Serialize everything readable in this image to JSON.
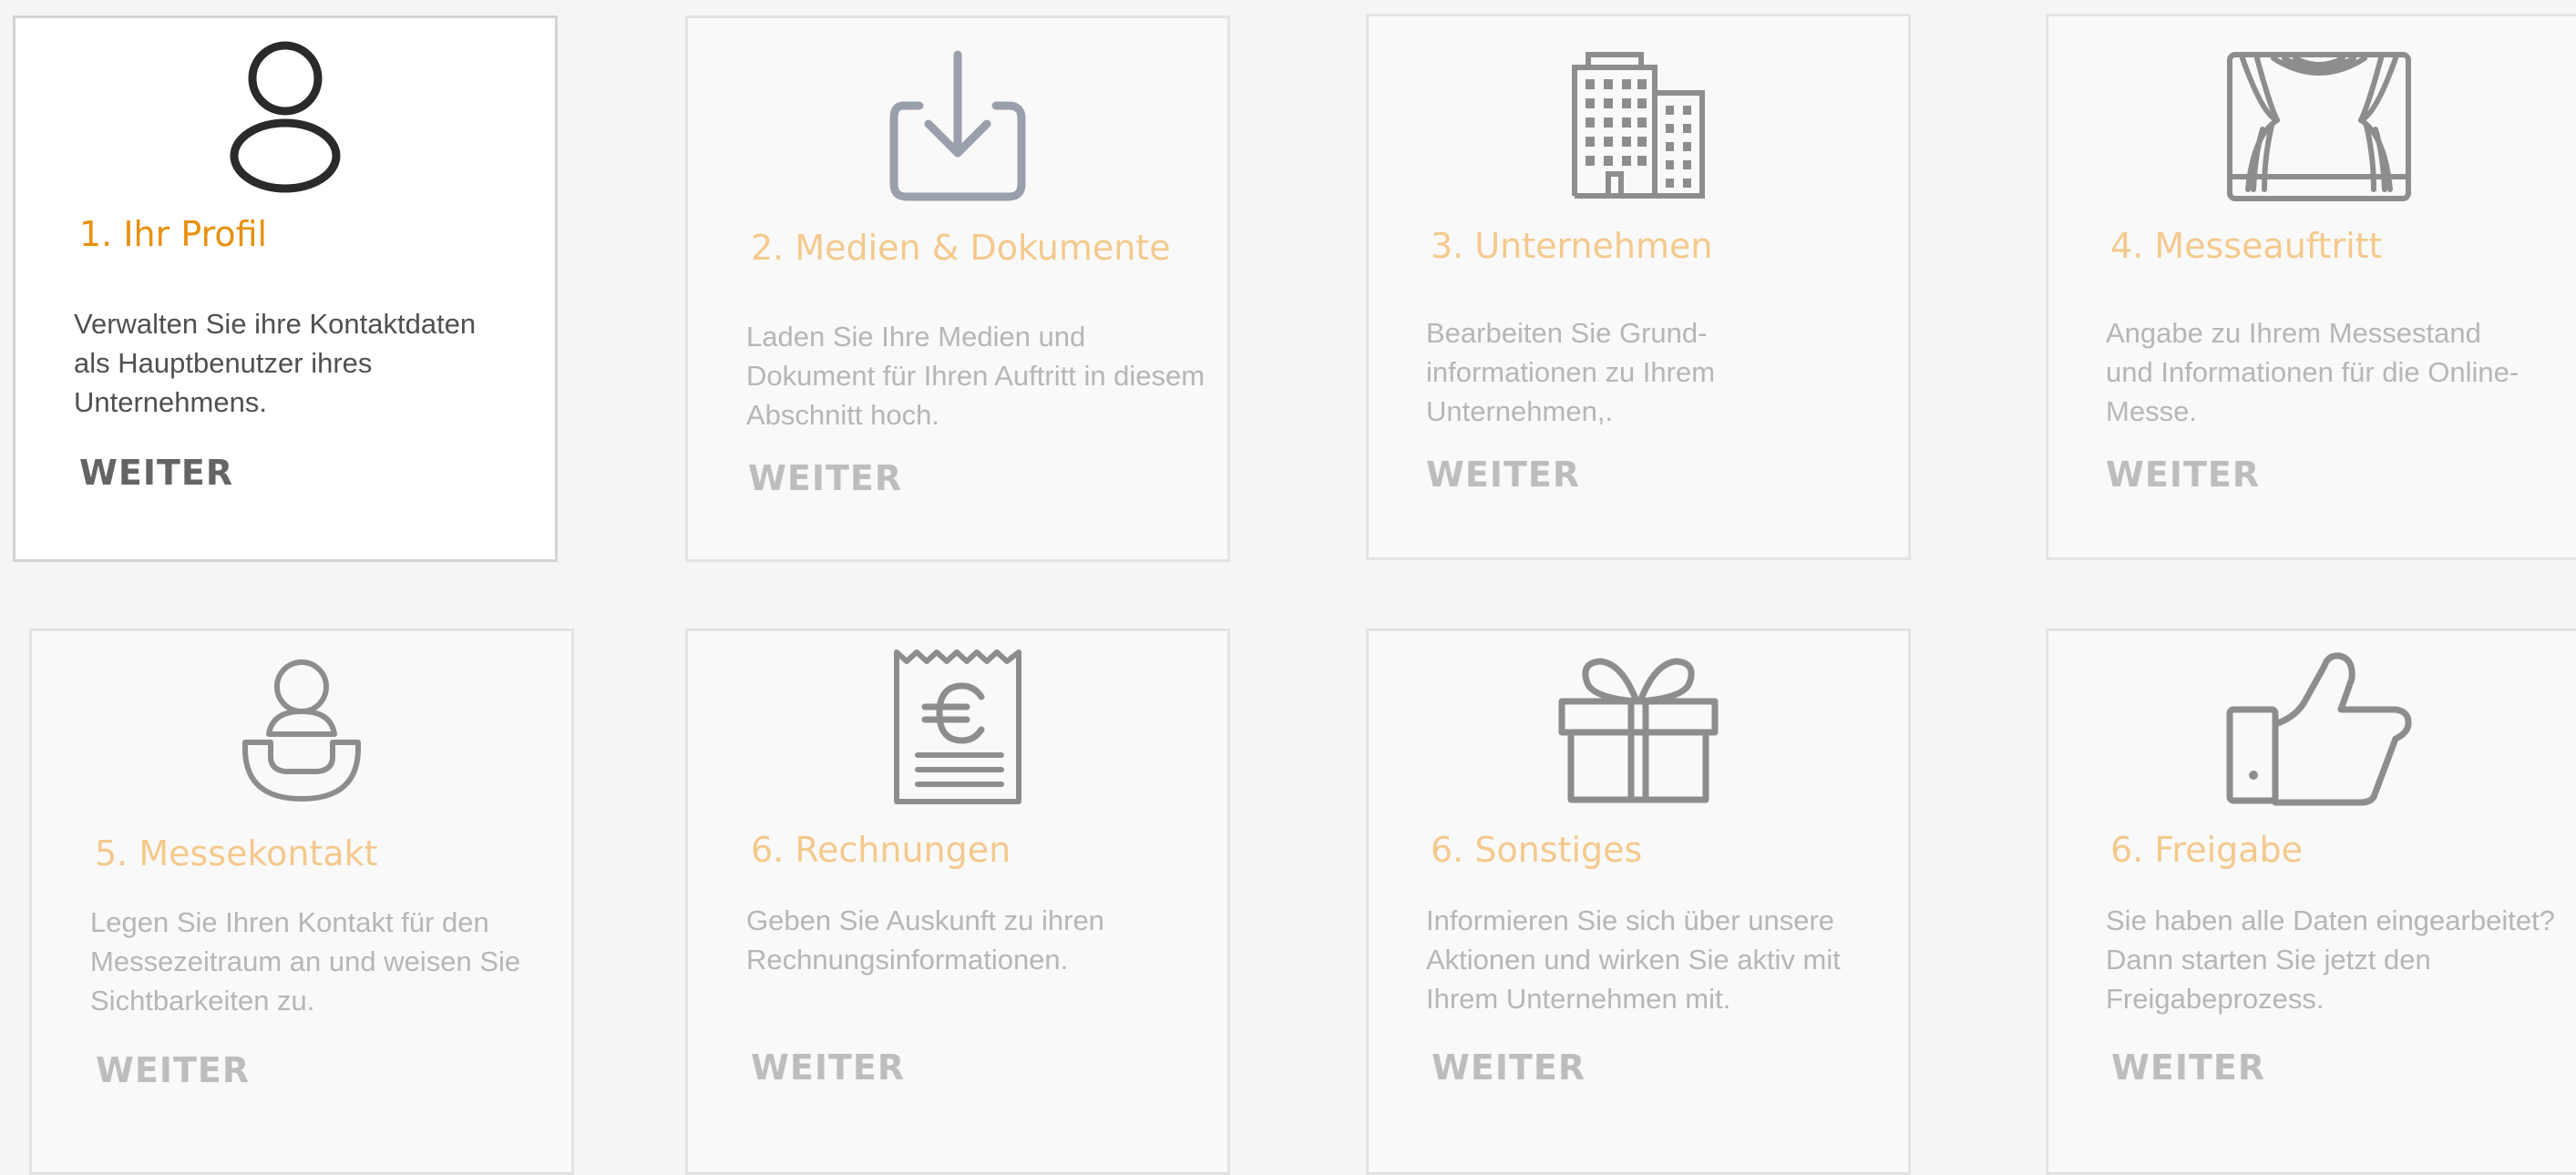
{
  "cards": [
    {
      "title": "1. Ihr Profil",
      "description": "Verwalten Sie ihre Kontaktdaten als Hauptbenutzer ihres Unternehmens.",
      "cta": "WEITER",
      "icon": "user-icon",
      "active": true
    },
    {
      "title": "2. Medien & Dokumente",
      "description": "Laden Sie Ihre Medien und Dokument für Ihren Auftritt in diesem Abschnitt hoch.",
      "cta": "WEITER",
      "icon": "upload-icon",
      "active": false
    },
    {
      "title": "3. Unternehmen",
      "description": "Bearbeiten Sie Grund-informationen zu Ihrem Unternehmen,.",
      "cta": "WEITER",
      "icon": "building-icon",
      "active": false
    },
    {
      "title": "4. Messeauftritt",
      "description": "Angabe zu Ihrem Messestand und Informationen für die Online-Messe.",
      "cta": "WEITER",
      "icon": "stage-curtain-icon",
      "active": false
    },
    {
      "title": "5. Messekontakt",
      "description": "Legen Sie Ihren Kontakt für den Messezeitraum an und weisen Sie Sichtbarkeiten zu.",
      "cta": "WEITER",
      "icon": "contact-phone-icon",
      "active": false
    },
    {
      "title": "6. Rechnungen",
      "description": "Geben Sie Auskunft zu ihren Rechnungsinformationen.",
      "cta": "WEITER",
      "icon": "euro-receipt-icon",
      "active": false
    },
    {
      "title": "6. Sonstiges",
      "description": "Informieren Sie sich über unsere Aktionen und wirken Sie aktiv mit Ihrem Unternehmen mit.",
      "cta": "WEITER",
      "icon": "gift-icon",
      "active": false
    },
    {
      "title": "6. Freigabe",
      "description": "Sie haben alle Daten eingearbeitet? Dann starten Sie jetzt den Freigabeprozess.",
      "cta": "WEITER",
      "icon": "thumbs-up-icon",
      "active": false
    }
  ],
  "colors": {
    "accent_active": "#e9900f",
    "accent_muted": "#f4c98c",
    "icon_active": "#2a2a2a",
    "icon_muted": "#8d8d8d",
    "icon_upload": "#9a9fac"
  }
}
